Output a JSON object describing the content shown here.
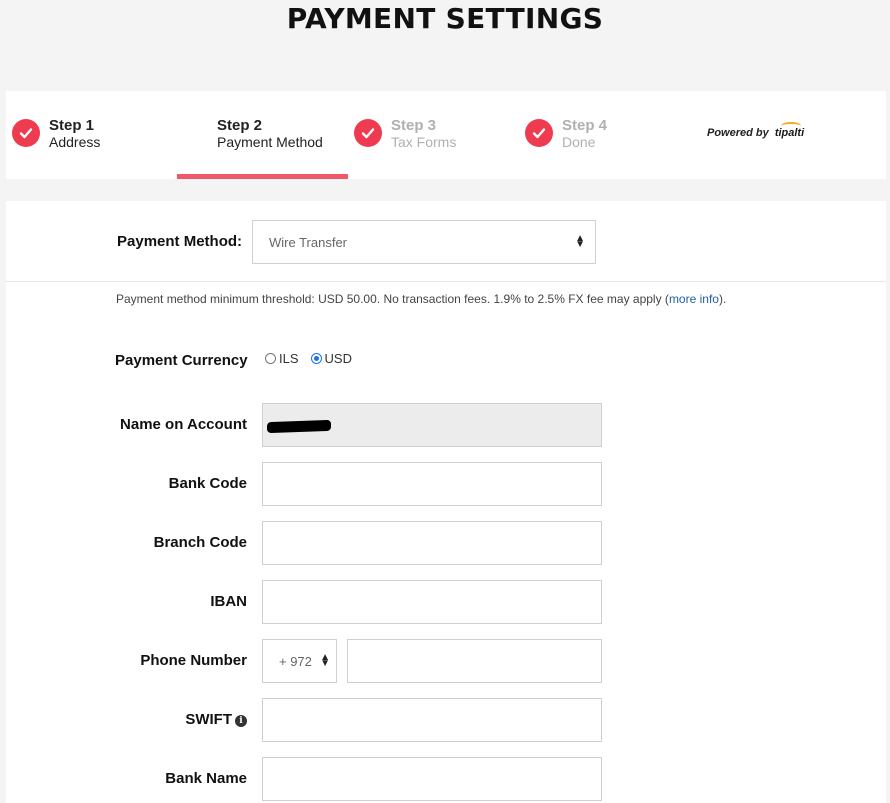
{
  "page": {
    "title": "PAYMENT SETTINGS"
  },
  "steps": [
    {
      "num": "Step 1",
      "name": "Address",
      "checked": true,
      "muted": false
    },
    {
      "num": "Step 2",
      "name": "Payment Method",
      "checked": false,
      "muted": false,
      "active": true
    },
    {
      "num": "Step 3",
      "name": "Tax Forms",
      "checked": true,
      "muted": true
    },
    {
      "num": "Step 4",
      "name": "Done",
      "checked": true,
      "muted": true
    }
  ],
  "powered": {
    "prefix": "Powered by",
    "brand": "tipalti"
  },
  "payment_method": {
    "label": "Payment Method:",
    "value": "Wire Transfer"
  },
  "note": {
    "text": "Payment method minimum threshold: USD 50.00. No transaction fees. 1.9% to 2.5% FX fee may apply (",
    "link": "more info",
    "suffix": ")."
  },
  "currency": {
    "label": "Payment Currency",
    "options": [
      {
        "label": "ILS",
        "selected": false
      },
      {
        "label": "USD",
        "selected": true
      }
    ]
  },
  "fields": {
    "name_on_account": {
      "label": "Name on Account",
      "value": ""
    },
    "bank_code": {
      "label": "Bank Code",
      "value": ""
    },
    "branch_code": {
      "label": "Branch Code",
      "value": ""
    },
    "iban": {
      "label": "IBAN",
      "value": ""
    },
    "phone": {
      "label": "Phone Number",
      "country_code": "+ 972",
      "value": ""
    },
    "swift": {
      "label": "SWIFT",
      "value": ""
    },
    "bank_name": {
      "label": "Bank Name",
      "value": ""
    }
  },
  "colors": {
    "accent": "#ef3b4f",
    "underline": "#ef5866",
    "link": "#1f5fa6"
  }
}
